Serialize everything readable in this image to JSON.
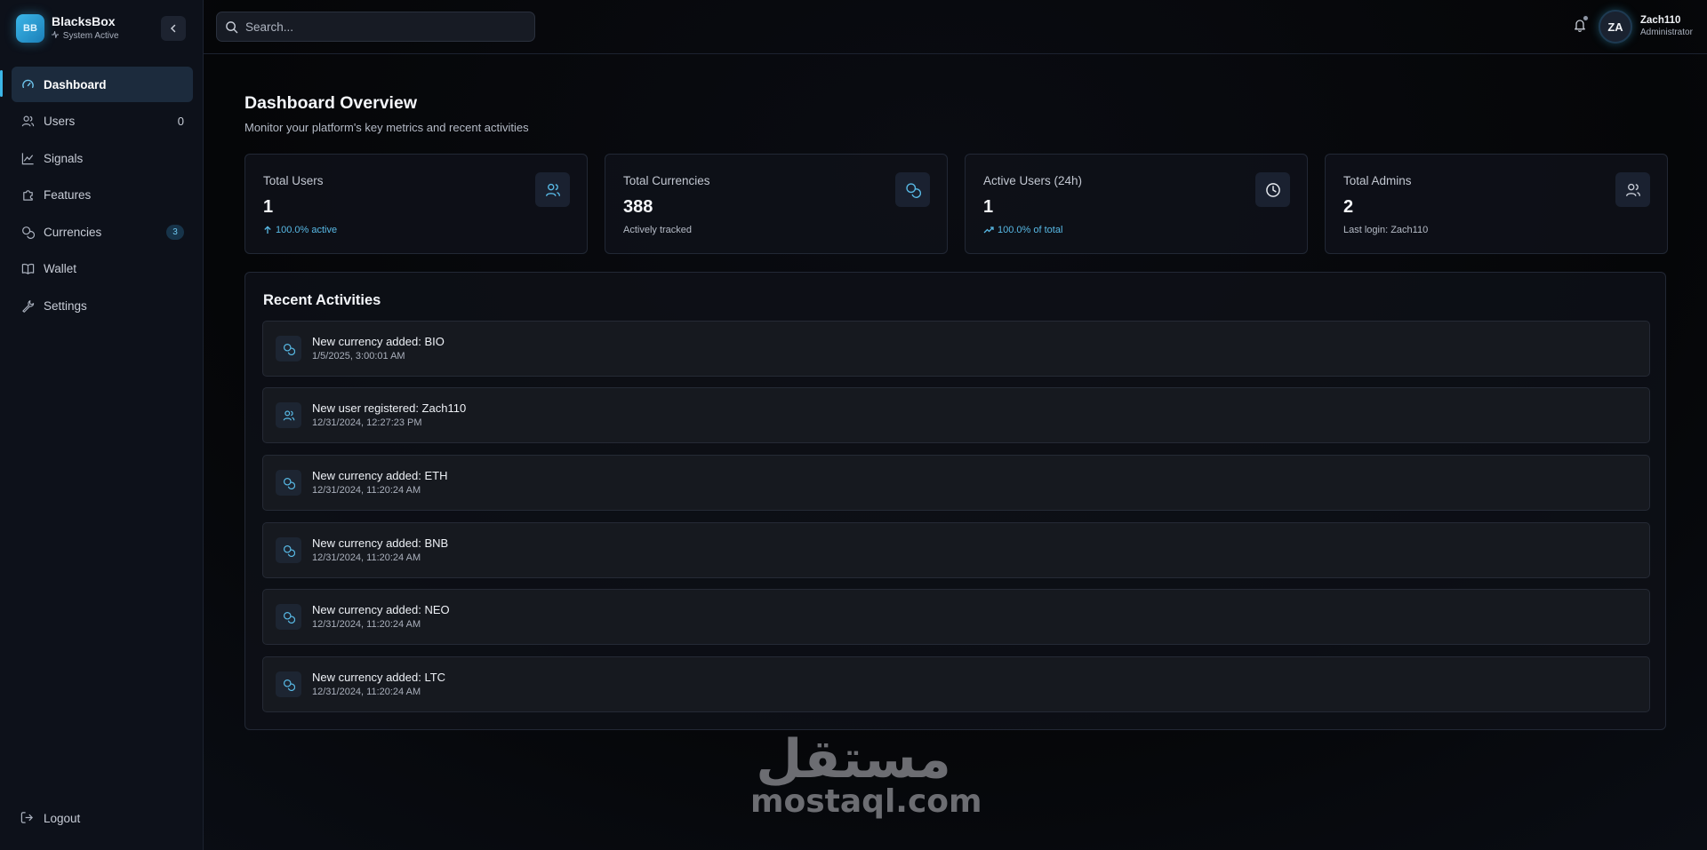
{
  "brand": {
    "logo_text": "BB",
    "name": "BlacksBox",
    "status": "System Active"
  },
  "sidebar": {
    "items": [
      {
        "label": "Dashboard",
        "icon": "gauge-icon",
        "active": true
      },
      {
        "label": "Users",
        "icon": "users-icon",
        "count": "0"
      },
      {
        "label": "Signals",
        "icon": "chart-line-icon"
      },
      {
        "label": "Features",
        "icon": "puzzle-icon"
      },
      {
        "label": "Currencies",
        "icon": "coins-icon",
        "badge": "3"
      },
      {
        "label": "Wallet",
        "icon": "book-open-icon"
      },
      {
        "label": "Settings",
        "icon": "wrench-icon"
      }
    ],
    "logout_label": "Logout"
  },
  "topbar": {
    "search_placeholder": "Search...",
    "user": {
      "initials": "ZA",
      "name": "Zach110",
      "role": "Administrator"
    }
  },
  "main": {
    "title": "Dashboard Overview",
    "subtitle": "Monitor your platform's key metrics and recent activities"
  },
  "cards": [
    {
      "label": "Total Users",
      "value": "1",
      "foot": "100.0% active",
      "icon": "users-icon"
    },
    {
      "label": "Total Currencies",
      "value": "388",
      "foot": "Actively tracked",
      "icon": "coins-icon"
    },
    {
      "label": "Active Users (24h)",
      "value": "1",
      "foot": "100.0% of total",
      "icon": "clock-icon"
    },
    {
      "label": "Total Admins",
      "value": "2",
      "foot": "Last login: Zach110",
      "icon": "users-icon"
    }
  ],
  "activities": {
    "title": "Recent Activities",
    "items": [
      {
        "title": "New currency added: BIO",
        "time": "1/5/2025, 3:00:01 AM",
        "icon": "coins-icon"
      },
      {
        "title": "New user registered: Zach110",
        "time": "12/31/2024, 12:27:23 PM",
        "icon": "users-icon"
      },
      {
        "title": "New currency added: ETH",
        "time": "12/31/2024, 11:20:24 AM",
        "icon": "coins-icon"
      },
      {
        "title": "New currency added: BNB",
        "time": "12/31/2024, 11:20:24 AM",
        "icon": "coins-icon"
      },
      {
        "title": "New currency added: NEO",
        "time": "12/31/2024, 11:20:24 AM",
        "icon": "coins-icon"
      },
      {
        "title": "New currency added: LTC",
        "time": "12/31/2024, 11:20:24 AM",
        "icon": "coins-icon"
      }
    ]
  },
  "watermark": {
    "arabic": "مستقل",
    "latin": "mostaql.com"
  },
  "colors": {
    "accent": "#3bb6e8",
    "active_bg": "#1c2b3d",
    "background": "#050608"
  }
}
